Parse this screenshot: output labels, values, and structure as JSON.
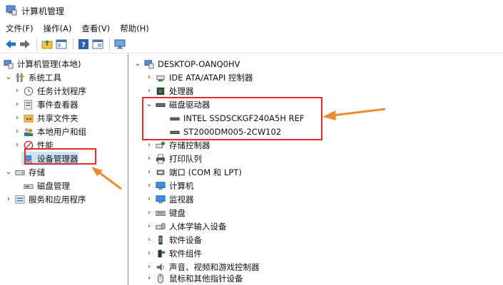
{
  "window": {
    "title": "计算机管理"
  },
  "menu": [
    "文件(F)",
    "操作(A)",
    "查看(V)",
    "帮助(H)"
  ],
  "toolbar": {
    "icons": [
      "back-arrow-icon",
      "forward-arrow-icon",
      "folder-up-icon",
      "show-hide-tree-icon",
      "help-icon",
      "properties-icon",
      "monitor-icon"
    ]
  },
  "left_tree": {
    "root": "计算机管理(本地)",
    "system_tools": "系统工具",
    "task_scheduler": "任务计划程序",
    "event_viewer": "事件查看器",
    "shared_folders": "共享文件夹",
    "local_users": "本地用户和组",
    "performance": "性能",
    "device_manager": "设备管理器",
    "storage": "存储",
    "disk_management": "磁盘管理",
    "services_apps": "服务和应用程序"
  },
  "right_tree": {
    "computer": "DESKTOP-OANQ0HV",
    "ide": "IDE ATA/ATAPI 控制器",
    "processor": "处理器",
    "disk_drives": "磁盘驱动器",
    "disk1": "INTEL SSDSCKGF240A5H REF",
    "disk2": "ST2000DM005-2CW102",
    "storage_ctrl": "存储控制器",
    "print_queue": "打印队列",
    "ports": "端口 (COM 和 LPT)",
    "computer_node": "计算机",
    "monitors": "监视器",
    "keyboards": "键盘",
    "hid": "人体学输入设备",
    "software_devices": "软件设备",
    "software_components": "软件组件",
    "sound": "声音、视频和游戏控制器",
    "mice": "鼠标和其他指针设备"
  },
  "colors": {
    "highlight": "#e52b2b",
    "arrow": "#f08a30"
  }
}
